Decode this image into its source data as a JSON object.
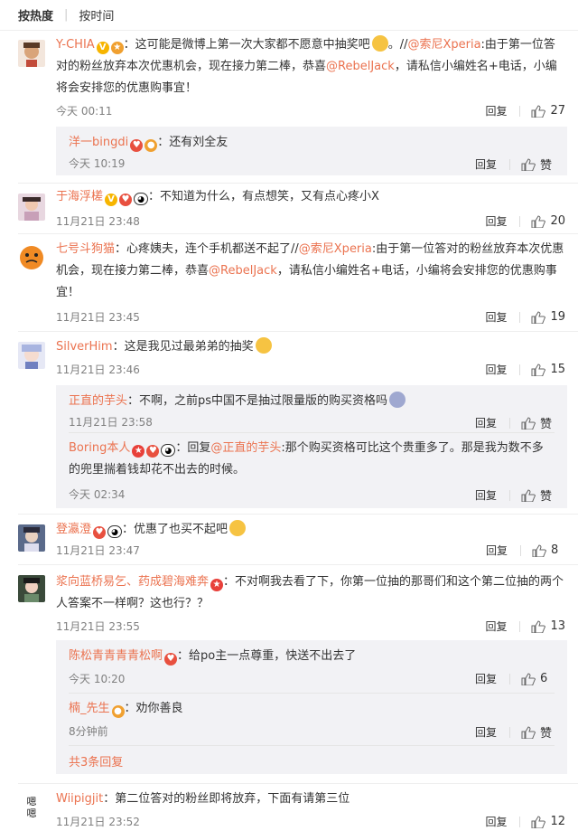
{
  "sort": {
    "hot": "按热度",
    "time": "按时间"
  },
  "comments": [
    {
      "user": "Y-CHIA",
      "text": "：这可能是微博上第一次大家都不愿意中抽奖吧",
      "text2": "。//",
      "link": "@索尼Xperia",
      "text3": ":由于第一位答对的粉丝放弃本次优惠机会，现在接力第二棒，恭喜",
      "mention": "@RebelJack",
      "text4": "，请私信小编姓名+电话，小编将会安排您的优惠购事宜！",
      "time": "今天 00:11",
      "reply": "回复",
      "likes": "27"
    },
    {
      "user": "于海浮槎",
      "text": "：不知道为什么，有点想笑，又有点心疼小X",
      "time": "11月21日 23:48",
      "reply": "回复",
      "likes": "20"
    },
    {
      "user": "七号斗狗猫",
      "text": "：心疼姨夫，连个手机都送不起了//",
      "link": "@索尼Xperia",
      "text3": ":由于第一位答对的粉丝放弃本次优惠机会，现在接力第二棒，恭喜",
      "mention": "@RebelJack",
      "text4": "，请私信小编姓名+电话，小编将会安排您的优惠购事宜！",
      "time": "11月21日 23:45",
      "reply": "回复",
      "likes": "19"
    },
    {
      "user": "SilverHim",
      "text": "：这是我见过最弟弟的抽奖",
      "time": "11月21日 23:46",
      "reply": "回复",
      "likes": "15"
    },
    {
      "user": "登瀛澄",
      "text": "：优惠了也买不起吧",
      "time": "11月21日 23:47",
      "reply": "回复",
      "likes": "8"
    },
    {
      "user": "浆向蓝桥易乞、药成碧海难奔",
      "text": "：不对啊我去看了下，你第一位抽的那哥们和这个第二位抽的两个人答案不一样啊？这也行？？",
      "time": "11月21日 23:55",
      "reply": "回复",
      "likes": "13"
    },
    {
      "user": "Wiipigjit",
      "text": "：第二位答对的粉丝即将放弃，下面有请第三位",
      "time": "11月21日 23:52",
      "reply": "回复",
      "likes": "12"
    }
  ],
  "subs": [
    {
      "user": "洋一bingdi",
      "text": "：还有刘全友",
      "time": "今天 10:19",
      "reply": "回复",
      "likes": "赞"
    },
    {
      "user": "正直的芋头",
      "text": "：不啊，之前ps中国不是抽过限量版的购买资格吗",
      "time": "11月21日 23:58",
      "reply": "回复",
      "likes": "赞"
    },
    {
      "user": "Boring本人",
      "text": "：回复",
      "mention": "@正直的芋头",
      "text2": ":那个购买资格可比这个贵重多了。那是我为数不多的兜里揣着钱却花不出去的时候。",
      "time": "今天 02:34",
      "reply": "回复",
      "likes": "赞"
    },
    {
      "user": "陈松青青青青松啊",
      "text": "：给po主一点尊重，快送不出去了",
      "time": "今天 10:20",
      "reply": "回复",
      "likes": "6"
    },
    {
      "user": "楠_先生",
      "text": "：劝你善良",
      "time": "8分钟前",
      "reply": "回复",
      "likes": "赞"
    }
  ],
  "more": "共3条回复",
  "colors": {
    "accent": "#eb7350",
    "meta": "#808080",
    "subbg": "#f2f2f5"
  }
}
